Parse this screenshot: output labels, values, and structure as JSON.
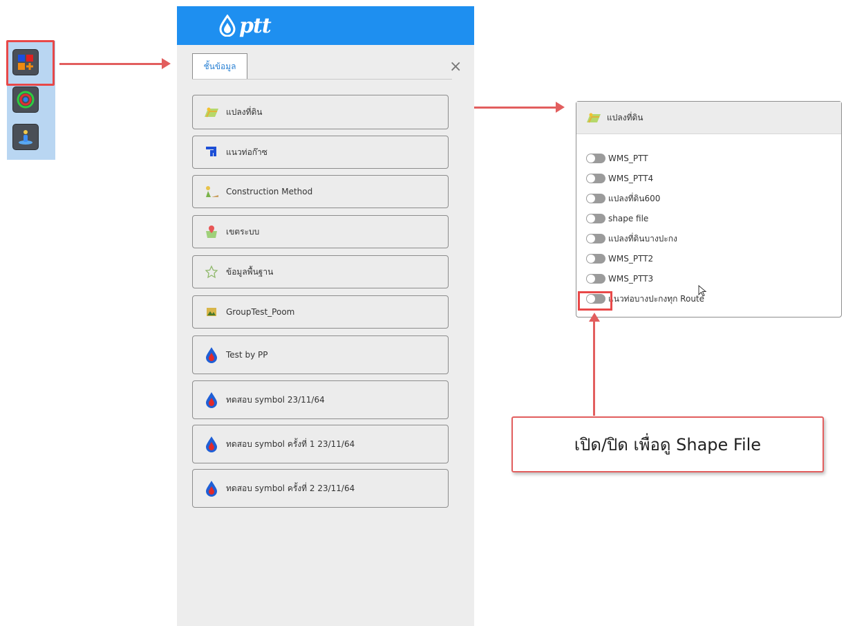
{
  "mini_toolbar": {
    "buttons": [
      {
        "icon": "layers-add-icon",
        "highlighted": true
      },
      {
        "icon": "basemap-circle-icon",
        "highlighted": false
      },
      {
        "icon": "person-location-icon",
        "highlighted": false
      }
    ]
  },
  "panel": {
    "logo_text": "ptt",
    "tab_label": "ชั้นข้อมูล",
    "close_symbol": "×",
    "layers": [
      {
        "label": "แปลงที่ดิน",
        "icon": "land-parcel-icon"
      },
      {
        "label": "แนวท่อก๊าซ",
        "icon": "gas-pipe-icon"
      },
      {
        "label": "Construction Method",
        "icon": "construction-icon"
      },
      {
        "label": "เขตระบบ",
        "icon": "map-pin-icon"
      },
      {
        "label": "ข้อมูลพื้นฐาน",
        "icon": "star-outline-icon"
      },
      {
        "label": "GroupTest_Poom",
        "icon": "image-icon"
      },
      {
        "label": "Test by PP",
        "icon": "ptt-drop-icon"
      },
      {
        "label": "ทดสอบ symbol 23/11/64",
        "icon": "ptt-drop-icon"
      },
      {
        "label": "ทดสอบ symbol ครั้งที่ 1 23/11/64",
        "icon": "ptt-drop-icon"
      },
      {
        "label": "ทดสอบ symbol ครั้งที่ 2 23/11/64",
        "icon": "ptt-drop-icon"
      }
    ]
  },
  "popup": {
    "title": "แปลงที่ดิน",
    "toggles": [
      {
        "label": "WMS_PTT",
        "on": false
      },
      {
        "label": "WMS_PTT4",
        "on": false
      },
      {
        "label": "แปลงที่ดิน600",
        "on": false
      },
      {
        "label": "shape file",
        "on": false
      },
      {
        "label": "แปลงที่ดินบางปะกง",
        "on": false
      },
      {
        "label": "WMS_PTT2",
        "on": false
      },
      {
        "label": "WMS_PTT3",
        "on": false
      },
      {
        "label": "แนวท่อบางปะกงทุก Route",
        "on": false,
        "highlighted": true
      }
    ]
  },
  "callout": {
    "text": "เปิด/ปิด เพื่อดู Shape File"
  },
  "colors": {
    "header_blue": "#1e8ff0",
    "annotation_red": "#e25e5e",
    "panel_bg": "#ededed",
    "tab_text_blue": "#2b82d4"
  }
}
